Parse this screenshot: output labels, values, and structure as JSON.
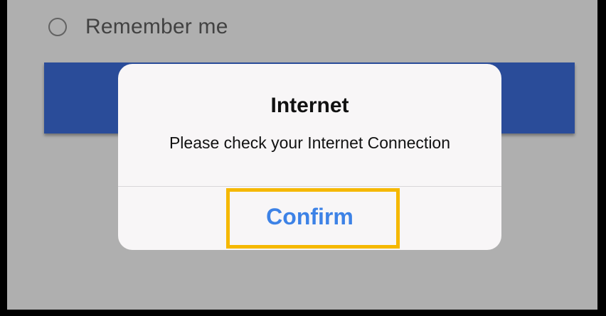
{
  "login_form": {
    "remember_me_label": "Remember me",
    "login_button_label": ""
  },
  "alert": {
    "title": "Internet",
    "message": "Please check your Internet Connection",
    "confirm_label": "Confirm"
  },
  "colors": {
    "primary_button": "#3d6edc",
    "confirm_text": "#3d82e6",
    "highlight": "#f5b800",
    "alert_background": "#f8f6f7"
  }
}
